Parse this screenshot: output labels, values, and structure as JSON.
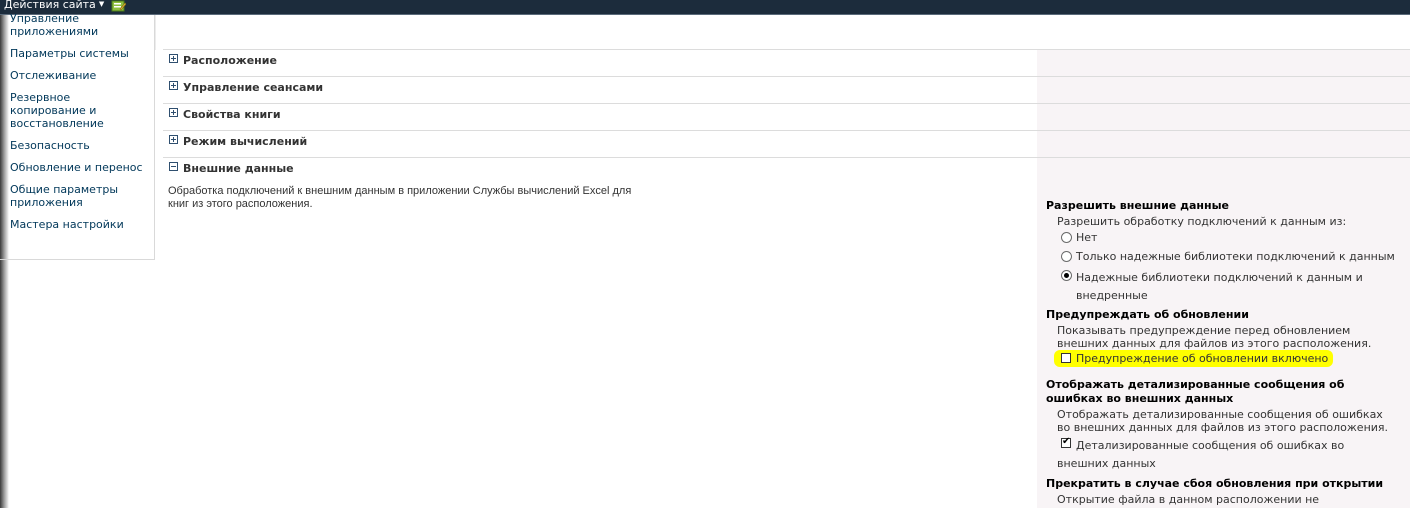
{
  "topbar": {
    "site_actions_label": "Действия сайта",
    "icon": "edit-page-icon"
  },
  "quicklaunch": {
    "items": [
      {
        "label": "Управление приложениями"
      },
      {
        "label": "Параметры системы"
      },
      {
        "label": "Отслеживание"
      },
      {
        "label": "Резервное копирование и восстановление"
      },
      {
        "label": "Безопасность"
      },
      {
        "label": "Обновление и перенос"
      },
      {
        "label": "Общие параметры приложения"
      },
      {
        "label": "Мастера настройки"
      }
    ]
  },
  "sections": [
    {
      "title": "Расположение",
      "state": "collapsed"
    },
    {
      "title": "Управление сеансами",
      "state": "collapsed"
    },
    {
      "title": "Свойства книги",
      "state": "collapsed"
    },
    {
      "title": "Режим вычислений",
      "state": "collapsed"
    },
    {
      "title": "Внешние данные",
      "state": "expanded"
    }
  ],
  "external_data": {
    "description": "Обработка подключений к внешним данным в приложении Службы вычислений Excel для книг из этого расположения.",
    "allow": {
      "title": "Разрешить внешние данные",
      "subtitle": "Разрешить обработку подключений к данным из:",
      "options": [
        {
          "label": "Нет",
          "selected": false
        },
        {
          "label": "Только надежные библиотеки подключений к данным",
          "selected": false
        },
        {
          "label": "Надежные библиотеки подключений к данным и внедренные",
          "selected": true
        }
      ]
    },
    "warn": {
      "title": "Предупреждать об обновлении",
      "desc": "Показывать предупреждение перед обновлением внешних данных для файлов из этого расположения.",
      "checkbox_label": "Предупреждение об обновлении включено",
      "checked": false,
      "highlight_color": "#ffff00"
    },
    "errors": {
      "title": "Отображать детализированные сообщения об ошибках во внешних данных",
      "desc": "Отображать детализированные сообщения об ошибках во внешних данных для файлов из этого расположения.",
      "checkbox_label": "Детализированные сообщения об ошибках во внешних данных",
      "checked": true
    },
    "stop": {
      "title": "Прекратить в случае сбоя обновления при открытии",
      "desc": "Открытие файла в данном расположении не"
    }
  }
}
